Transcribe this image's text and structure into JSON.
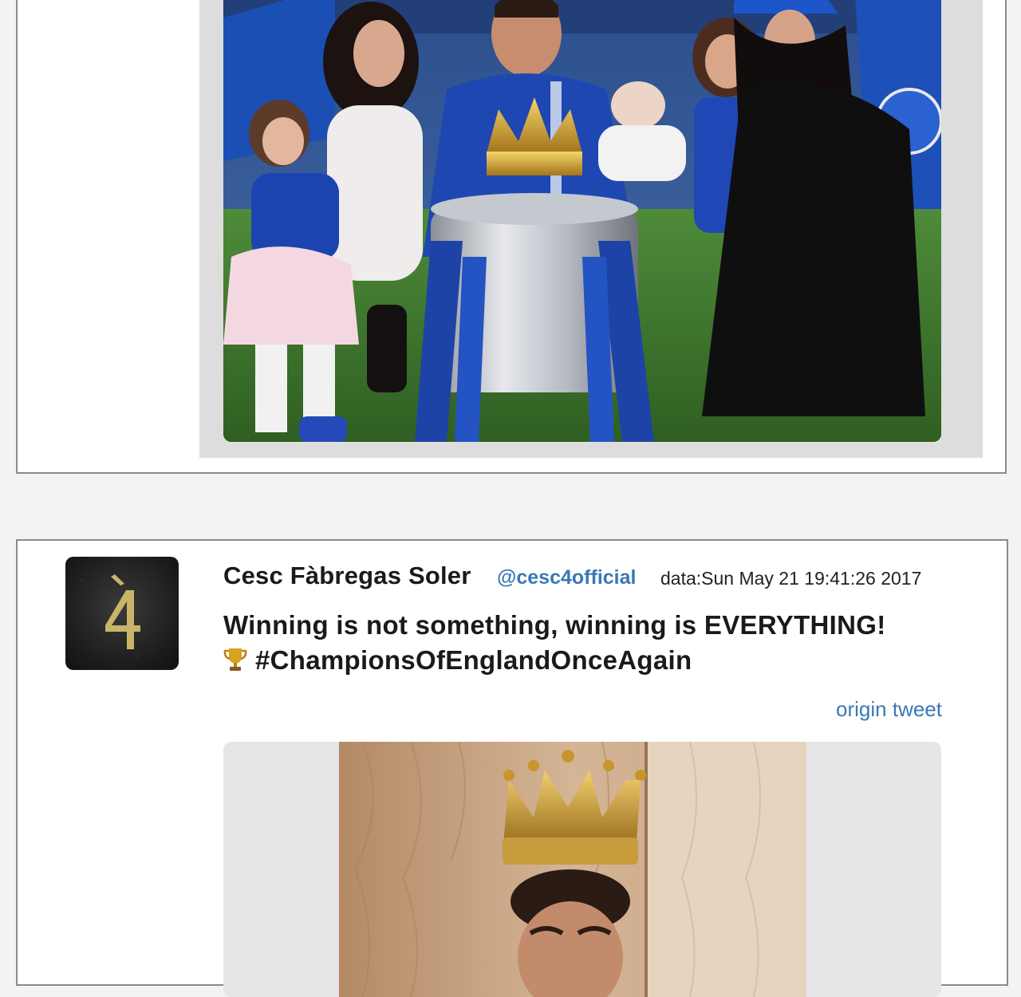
{
  "tweet_previous": {
    "image_alt": "Cesc Fàbregas with family and the Premier League trophy"
  },
  "tweet": {
    "user_name": "Cesc Fàbregas Soler",
    "handle": "@cesc4official",
    "date": "data:Sun May 21 19:41:26 2017",
    "text_line1": "Winning is not something, winning is EVERYTHING!",
    "text_line2": "#ChampionsOfEnglandOnceAgain",
    "trophy_icon": "trophy-icon",
    "origin_link": "origin tweet",
    "avatar_glyph": "4̀",
    "image_alt": "Cesc Fàbregas wearing the Premier League crown"
  },
  "colors": {
    "page_bg": "#f2f3f5",
    "card_border": "#8a8a8a",
    "link": "#3a78b5",
    "media_bg_top": "#dddddd",
    "media_bg": "#e6e6e6"
  }
}
